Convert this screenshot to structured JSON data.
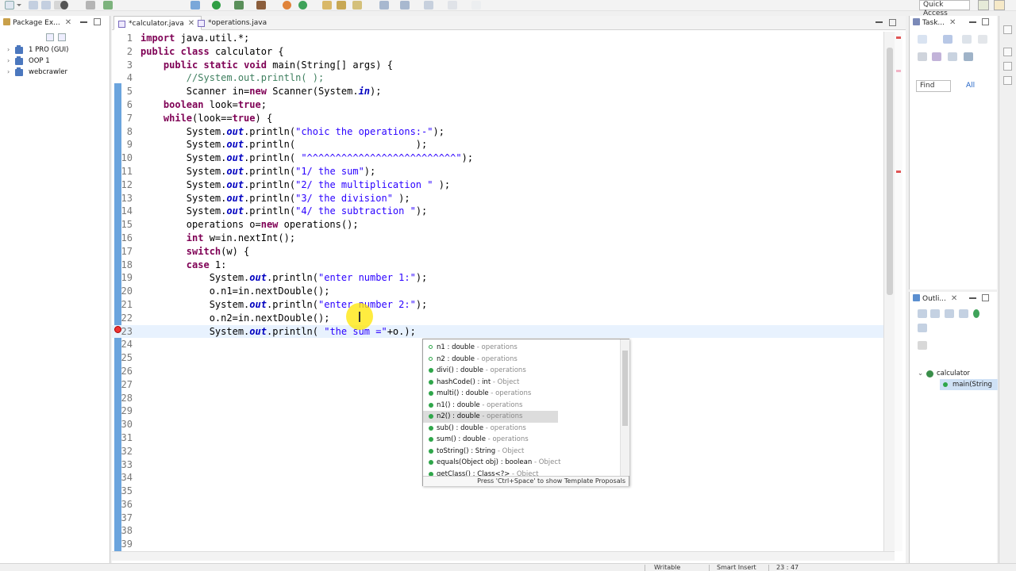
{
  "toolbar": {
    "quick_access": "Quick Access"
  },
  "package_explorer": {
    "tab_label": "Package Ex...",
    "projects": [
      {
        "label": "1 PRO (GUI)"
      },
      {
        "label": "OOP 1"
      },
      {
        "label": "webcrawler"
      }
    ]
  },
  "editor": {
    "tabs": [
      {
        "label": "*calculator.java",
        "active": true
      },
      {
        "label": "*operations.java",
        "active": false
      }
    ],
    "lines": [
      {
        "num": "1",
        "code": "import java.util.*;"
      },
      {
        "num": "2",
        "code": "public class calculator {"
      },
      {
        "num": "3",
        "code": "    public static void main(String[] args) {"
      },
      {
        "num": "4",
        "code": "        //System.out.println( );"
      },
      {
        "num": "5",
        "code": "        Scanner in=new Scanner(System.in);"
      },
      {
        "num": "6",
        "code": "    boolean look=true;"
      },
      {
        "num": "7",
        "code": "    while(look==true) {"
      },
      {
        "num": "8",
        "code": "        System.out.println(\"choic the operations:-\");"
      },
      {
        "num": "9",
        "code": "        System.out.println(                     );"
      },
      {
        "num": "10",
        "code": "        System.out.println( \"^^^^^^^^^^^^^^^^^^^^^^^^^^\");"
      },
      {
        "num": "11",
        "code": "        System.out.println(\"1/ the sum\");"
      },
      {
        "num": "12",
        "code": "        System.out.println(\"2/ the multiplication \" );"
      },
      {
        "num": "13",
        "code": "        System.out.println(\"3/ the division\" );"
      },
      {
        "num": "14",
        "code": "        System.out.println(\"4/ the subtraction \");"
      },
      {
        "num": "15",
        "code": "        operations o=new operations();"
      },
      {
        "num": "16",
        "code": "        int w=in.nextInt();"
      },
      {
        "num": "17",
        "code": "        switch(w) {"
      },
      {
        "num": "18",
        "code": "        case 1:"
      },
      {
        "num": "19",
        "code": "            System.out.println(\"enter number 1:\");"
      },
      {
        "num": "20",
        "code": "            o.n1=in.nextDouble();"
      },
      {
        "num": "21",
        "code": "            System.out.println(\"enter number 2:\");"
      },
      {
        "num": "22",
        "code": "            o.n2=in.nextDouble();"
      },
      {
        "num": "23",
        "code": "            System.out.println( \"the sum =\"+o.);"
      },
      {
        "num": "24",
        "code": ""
      },
      {
        "num": "25",
        "code": ""
      },
      {
        "num": "26",
        "code": ""
      },
      {
        "num": "27",
        "code": ""
      },
      {
        "num": "28",
        "code": ""
      },
      {
        "num": "29",
        "code": ""
      },
      {
        "num": "30",
        "code": ""
      },
      {
        "num": "31",
        "code": ""
      },
      {
        "num": "32",
        "code": ""
      },
      {
        "num": "33",
        "code": ""
      },
      {
        "num": "34",
        "code": ""
      },
      {
        "num": "35",
        "code": ""
      },
      {
        "num": "36",
        "code": ""
      },
      {
        "num": "37",
        "code": ""
      },
      {
        "num": "38",
        "code": ""
      },
      {
        "num": "39",
        "code": ""
      }
    ],
    "current_line": "23"
  },
  "completion": {
    "proposals": [
      {
        "name": "n1 : double",
        "qualifier": " - operations",
        "kind": "field"
      },
      {
        "name": "n2 : double",
        "qualifier": " - operations",
        "kind": "field"
      },
      {
        "name": "divi() : double",
        "qualifier": " - operations",
        "kind": "method"
      },
      {
        "name": "hashCode() : int",
        "qualifier": " - Object",
        "kind": "method"
      },
      {
        "name": "multi() : double",
        "qualifier": " - operations",
        "kind": "method"
      },
      {
        "name": "n1() : double",
        "qualifier": " - operations",
        "kind": "method"
      },
      {
        "name": "n2() : double",
        "qualifier": " - operations",
        "kind": "method",
        "selected": true
      },
      {
        "name": "sub() : double",
        "qualifier": " - operations",
        "kind": "method"
      },
      {
        "name": "sum() : double",
        "qualifier": " - operations",
        "kind": "method"
      },
      {
        "name": "toString() : String",
        "qualifier": " - Object",
        "kind": "method"
      },
      {
        "name": "equals(Object obj) : boolean",
        "qualifier": " - Object",
        "kind": "method"
      },
      {
        "name": "getClass() : Class<?>",
        "qualifier": " - Object",
        "kind": "method"
      }
    ],
    "hint": "Press 'Ctrl+Space' to show Template Proposals"
  },
  "task_view": {
    "tab_label": "Task...",
    "find_placeholder": "Find",
    "all_label": "All"
  },
  "outline_view": {
    "tab_label": "Outli...",
    "items": [
      {
        "label": "calculator"
      },
      {
        "label": "main(String"
      }
    ]
  },
  "status_bar": {
    "writable": "Writable",
    "insert_mode": "Smart Insert",
    "position": "23 : 47"
  },
  "colors": {
    "keyword": "#7f0055",
    "string": "#2a00ff",
    "comment": "#3f7f5f",
    "field": "#0000c0",
    "ruler": "#6ba4dd"
  }
}
